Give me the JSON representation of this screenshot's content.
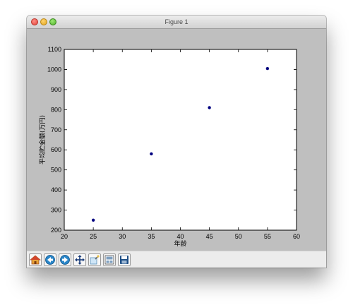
{
  "window": {
    "title": "Figure 1"
  },
  "toolbar": {
    "buttons": [
      {
        "name": "home",
        "icon": "home-icon"
      },
      {
        "name": "back",
        "icon": "arrow-left-icon"
      },
      {
        "name": "forward",
        "icon": "arrow-right-icon"
      },
      {
        "name": "pan",
        "icon": "move-icon"
      },
      {
        "name": "zoom",
        "icon": "zoom-icon"
      },
      {
        "name": "subplots",
        "icon": "configure-subplots-icon"
      },
      {
        "name": "save",
        "icon": "save-icon"
      }
    ]
  },
  "chart_data": {
    "type": "scatter",
    "title": "",
    "xlabel": "年龄",
    "ylabel": "平均贮金额(万円)",
    "xlim": [
      20,
      60
    ],
    "ylim": [
      200,
      1100
    ],
    "xticks": [
      20,
      25,
      30,
      35,
      40,
      45,
      50,
      55,
      60
    ],
    "yticks": [
      200,
      300,
      400,
      500,
      600,
      700,
      800,
      900,
      1000,
      1100
    ],
    "x": [
      25,
      35,
      45,
      55
    ],
    "y": [
      250,
      580,
      810,
      1005
    ],
    "grid": false,
    "marker_color": "#000080",
    "colors": {
      "figure_background": "#bfbfbf",
      "axes_background": "#ffffff"
    }
  }
}
